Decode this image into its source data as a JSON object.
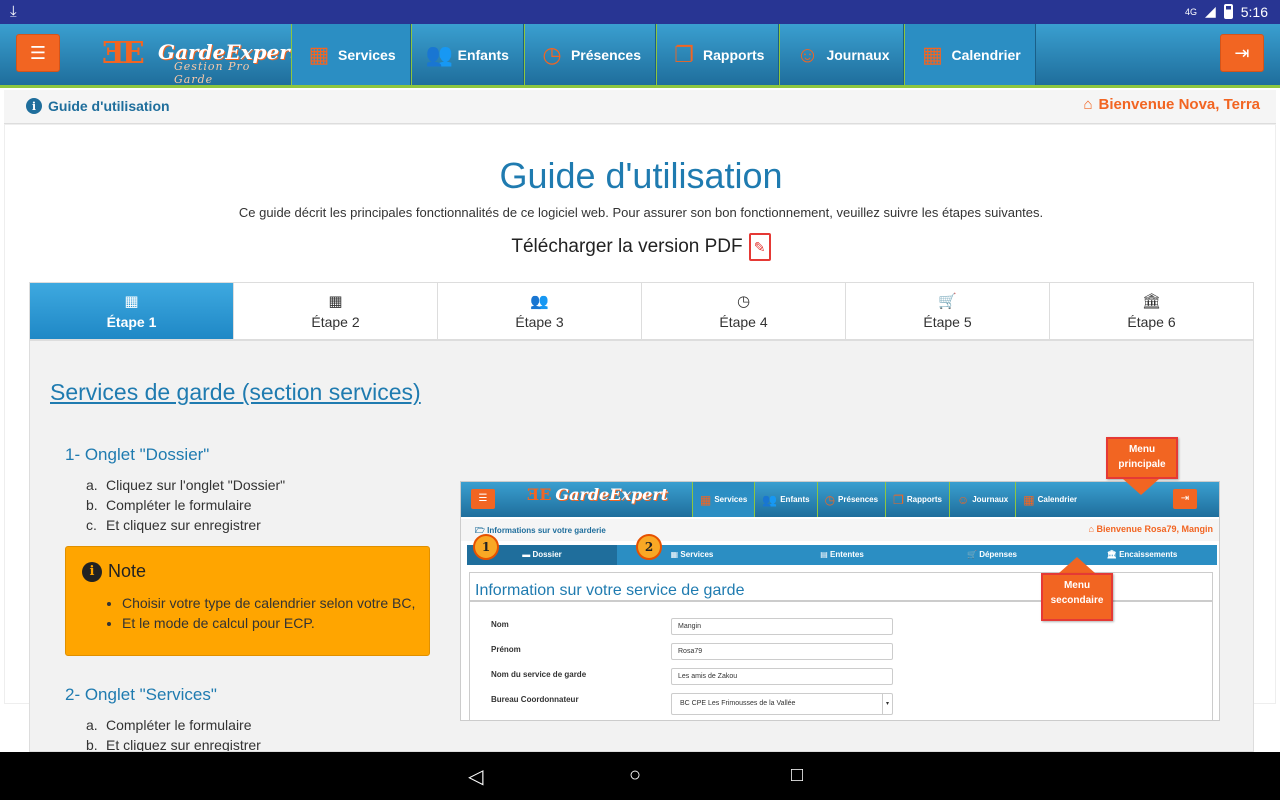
{
  "status": {
    "time": "5:16",
    "network": "4G"
  },
  "app": {
    "logo_mark": "ƎE",
    "logo_name": "GardeExpert",
    "logo_sub": "Gestion Pro Garde",
    "nav": [
      {
        "label": "Services",
        "icon": "calculator-icon",
        "glyph": "▦"
      },
      {
        "label": "Enfants",
        "icon": "users-icon",
        "glyph": "👥"
      },
      {
        "label": "Présences",
        "icon": "clock-icon",
        "glyph": "◷"
      },
      {
        "label": "Rapports",
        "icon": "files-icon",
        "glyph": "❐"
      },
      {
        "label": "Journaux",
        "icon": "smile-icon",
        "glyph": "☺"
      },
      {
        "label": "Calendrier",
        "icon": "calendar-icon",
        "glyph": "▦"
      }
    ],
    "colors": {
      "accent": "#f26522",
      "primary": "#1f7bb0",
      "green": "#8dc63f"
    }
  },
  "breadcrumb": {
    "label": "Guide d'utilisation",
    "welcome": "Bienvenue Nova, Terra"
  },
  "page": {
    "title": "Guide d'utilisation",
    "description": "Ce guide décrit les principales fonctionnalités de ce logiciel web. Pour assurer son bon fonctionnement, veuillez suivre les étapes suivantes.",
    "pdf_link": "Télécharger la version PDF"
  },
  "tabs": [
    {
      "label": "Étape 1",
      "glyph": "▦",
      "icon": "calculator-icon"
    },
    {
      "label": "Étape 2",
      "glyph": "▦",
      "icon": "calendar-icon"
    },
    {
      "label": "Étape 3",
      "glyph": "👥",
      "icon": "users-icon"
    },
    {
      "label": "Étape 4",
      "glyph": "◷",
      "icon": "clock-icon"
    },
    {
      "label": "Étape 5",
      "glyph": "🛒",
      "icon": "cart-icon"
    },
    {
      "label": "Étape 6",
      "glyph": "🏛",
      "icon": "bank-icon"
    }
  ],
  "section": {
    "title": "Services de garde (section services)",
    "step1": {
      "heading": "1- Onglet \"Dossier\"",
      "items": [
        "Cliquez sur l'onglet \"Dossier\"",
        "Compléter le formulaire",
        "Et cliquez sur enregistrer"
      ]
    },
    "note": {
      "title": "Note",
      "items": [
        "Choisir votre type de calendrier selon votre BC,",
        "Et le mode de calcul pour ECP."
      ]
    },
    "step2": {
      "heading": "2- Onglet \"Services\"",
      "items": [
        "Compléter le formulaire",
        "Et cliquez sur enregistrer"
      ]
    }
  },
  "screenshot": {
    "logo": "GardeExpert",
    "nav": [
      "Services",
      "Enfants",
      "Présences",
      "Rapports",
      "Journaux",
      "Calendrier"
    ],
    "breadcrumb": "Informations sur votre garderie",
    "welcome": "Bienvenue Rosa79, Mangin",
    "tabs": [
      "Dossier",
      "Services",
      "Ententes",
      "Dépenses",
      "Encaissements"
    ],
    "heading": "Information sur votre service de garde",
    "fields": [
      {
        "label": "Nom",
        "value": "Mangin"
      },
      {
        "label": "Prénom",
        "value": "Rosa79"
      },
      {
        "label": "Nom du service de garde",
        "value": "Les amis de Zakou"
      },
      {
        "label": "Bureau Coordonnateur",
        "value": "BC CPE Les Frimousses de la Vallée"
      }
    ],
    "callout_main": "Menu principale",
    "callout_secondary": "Menu secondaire",
    "badge1": "1",
    "badge2": "2"
  }
}
